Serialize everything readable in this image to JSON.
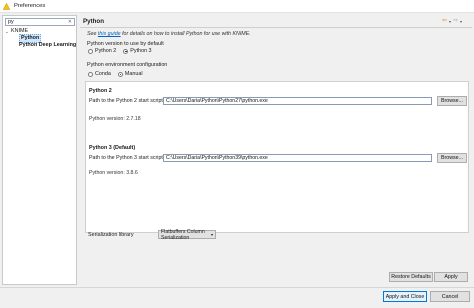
{
  "window": {
    "title": "Preferences"
  },
  "filter": {
    "value": "py",
    "clear_glyph": "✕"
  },
  "tree": {
    "root": {
      "label": "KNIME",
      "twisty": "⌄"
    },
    "children": [
      {
        "label": "Python"
      },
      {
        "label": "Python Deep Learning"
      }
    ]
  },
  "page": {
    "title": "Python",
    "nav": {
      "back": "⇦",
      "forward": "⇨",
      "dropdown": "▾"
    },
    "help": {
      "prefix": "See ",
      "link": "this guide",
      "suffix": " for details on how to install Python for use with KNIME."
    },
    "version_default": {
      "label": "Python version to use by default",
      "options": [
        {
          "label": "Python 2",
          "selected": false
        },
        {
          "label": "Python 3",
          "selected": true
        }
      ]
    },
    "env_config": {
      "label": "Python environment configuration",
      "options": [
        {
          "label": "Conda",
          "selected": false
        },
        {
          "label": "Manual",
          "selected": true
        }
      ]
    },
    "py2": {
      "heading": "Python 2",
      "path_label": "Path to the Python 2 start script",
      "path_value": "C:\\Users\\Daria\\Python\\Python27\\python.exe",
      "browse": "Browse...",
      "version": "Python version: 2.7.18"
    },
    "py3": {
      "heading": "Python 3 (Default)",
      "path_label": "Path to the Python 3 start script",
      "path_value": "C:\\Users\\Daria\\Python\\Python39\\python.exe",
      "browse": "Browse...",
      "version": "Python version: 3.8.6"
    },
    "serialization": {
      "label": "Serialization library",
      "value": "Flatbuffers Column Serialization",
      "caret": "▾"
    },
    "restore_defaults": "Restore Defaults",
    "apply": "Apply"
  },
  "footer": {
    "apply_close": "Apply and Close",
    "cancel": "Cancel"
  },
  "colors": {
    "accent": "#0078d7",
    "link": "#0563c1",
    "selection": "#cde8ff",
    "nav_back": "#d98c00"
  }
}
